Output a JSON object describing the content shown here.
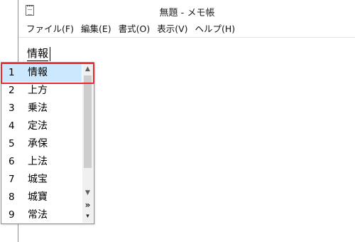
{
  "window": {
    "title": "無題 - メモ帳",
    "app_icon": "notepad-icon"
  },
  "menubar": {
    "items": [
      "ファイル(F)",
      "編集(E)",
      "書式(O)",
      "表示(V)",
      "ヘルプ(H)"
    ]
  },
  "editor": {
    "text": "情報"
  },
  "ime": {
    "selected_index": 0,
    "candidates": [
      {
        "num": "1",
        "word": "情報"
      },
      {
        "num": "2",
        "word": "上方"
      },
      {
        "num": "3",
        "word": "乗法"
      },
      {
        "num": "4",
        "word": "定法"
      },
      {
        "num": "5",
        "word": "承保"
      },
      {
        "num": "6",
        "word": "上法"
      },
      {
        "num": "7",
        "word": "城宝"
      },
      {
        "num": "8",
        "word": "城寶"
      },
      {
        "num": "9",
        "word": "常法"
      }
    ],
    "scroll_up_icon": "chevron-up-icon",
    "scroll_down_icon": "chevron-down-icon",
    "expand_symbol": "»",
    "menu_symbol": "▾",
    "colors": {
      "selection_fill": "#cce8ff",
      "highlight_outline": "#e8282c"
    }
  }
}
